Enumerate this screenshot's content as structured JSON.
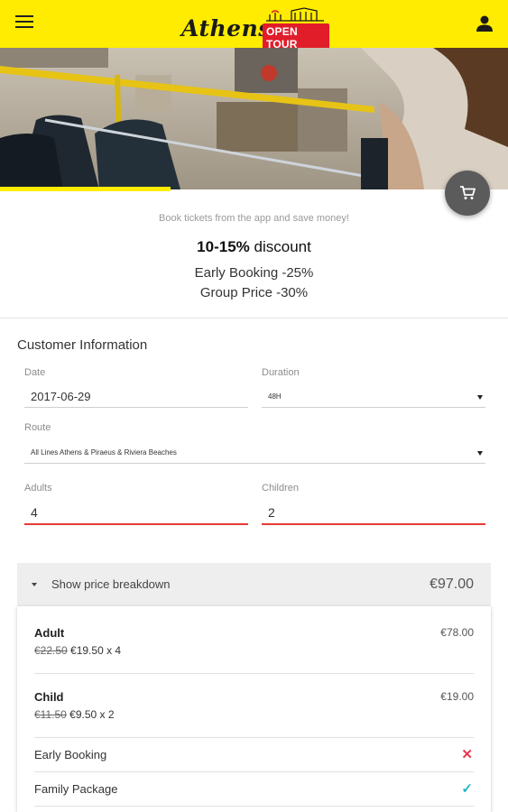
{
  "header": {
    "brand_script": "Athens",
    "brand_badge": "OPEN TOUR",
    "brand_color": "#ffec00",
    "badge_color": "#e11d2a",
    "menu_icon": "hamburger-menu-icon",
    "account_icon": "person-icon"
  },
  "hero": {
    "cart_icon": "shopping-cart-icon"
  },
  "promo": {
    "tagline": "Book tickets from the app and save money!",
    "discount_bold": "10-15%",
    "discount_rest": " discount",
    "early_booking": "Early Booking -25%",
    "group_price": "Group Price -30%"
  },
  "form": {
    "title": "Customer Information",
    "date": {
      "label": "Date",
      "value": "2017-06-29"
    },
    "duration": {
      "label": "Duration",
      "value": "48H"
    },
    "route": {
      "label": "Route",
      "value": "All Lines Athens &  Piraeus & Riviera Beaches"
    },
    "adults": {
      "label": "Adults",
      "value": "4"
    },
    "children": {
      "label": "Children",
      "value": "2"
    },
    "error_color": "#e53935"
  },
  "breakdown": {
    "toggle_label": "Show price breakdown",
    "total": "€97.00",
    "rows": [
      {
        "name": "Adult",
        "amount": "€78.00",
        "old_price": "€22.50",
        "new_price": " €19.50 x 4"
      },
      {
        "name": "Child",
        "amount": "€19.00",
        "old_price": "€11.50",
        "new_price": " €9.50 x 2"
      }
    ],
    "options": [
      {
        "label": "Early Booking",
        "mark": "✕",
        "icon": "cross-icon",
        "color": "#e53950"
      },
      {
        "label": "Family Package",
        "mark": "✓",
        "icon": "check-icon",
        "color": "#26b5c6"
      }
    ]
  }
}
